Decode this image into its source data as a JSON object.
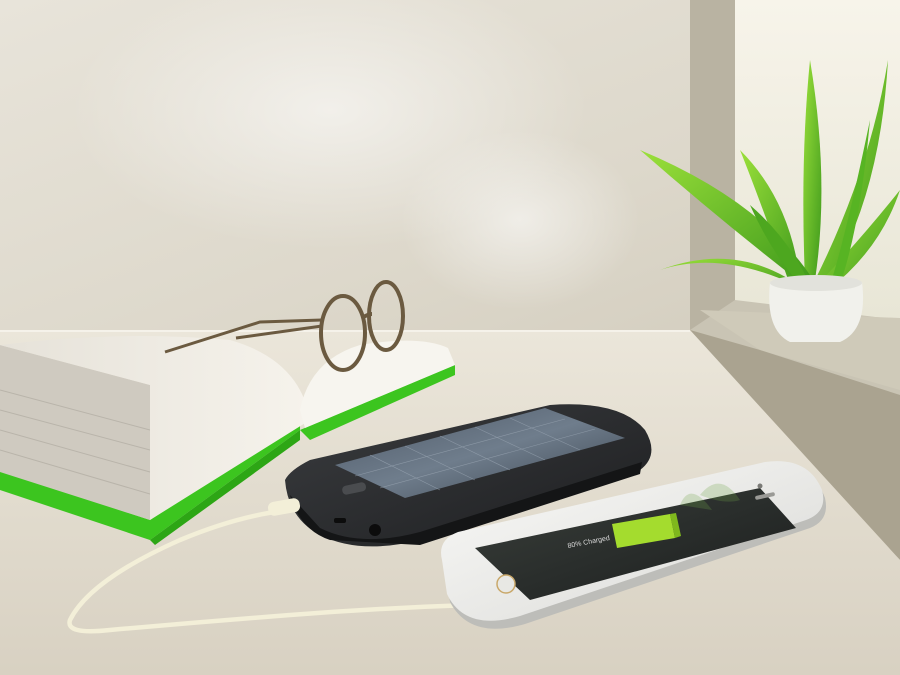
{
  "phone": {
    "battery_status": "80% Charged"
  },
  "colors": {
    "accent_green": "#3cc51f",
    "battery_fill": "#a4dc2e",
    "wall": "#ece8de",
    "desk": "#e3ddd0",
    "power_bank": "#2a2c2e",
    "phone_body": "#f2f2f0",
    "cable": "#f3efd8",
    "glasses_frame": "#6b5a40",
    "plant_leaf": "#6cc62a",
    "pot": "#f1f1ec"
  }
}
